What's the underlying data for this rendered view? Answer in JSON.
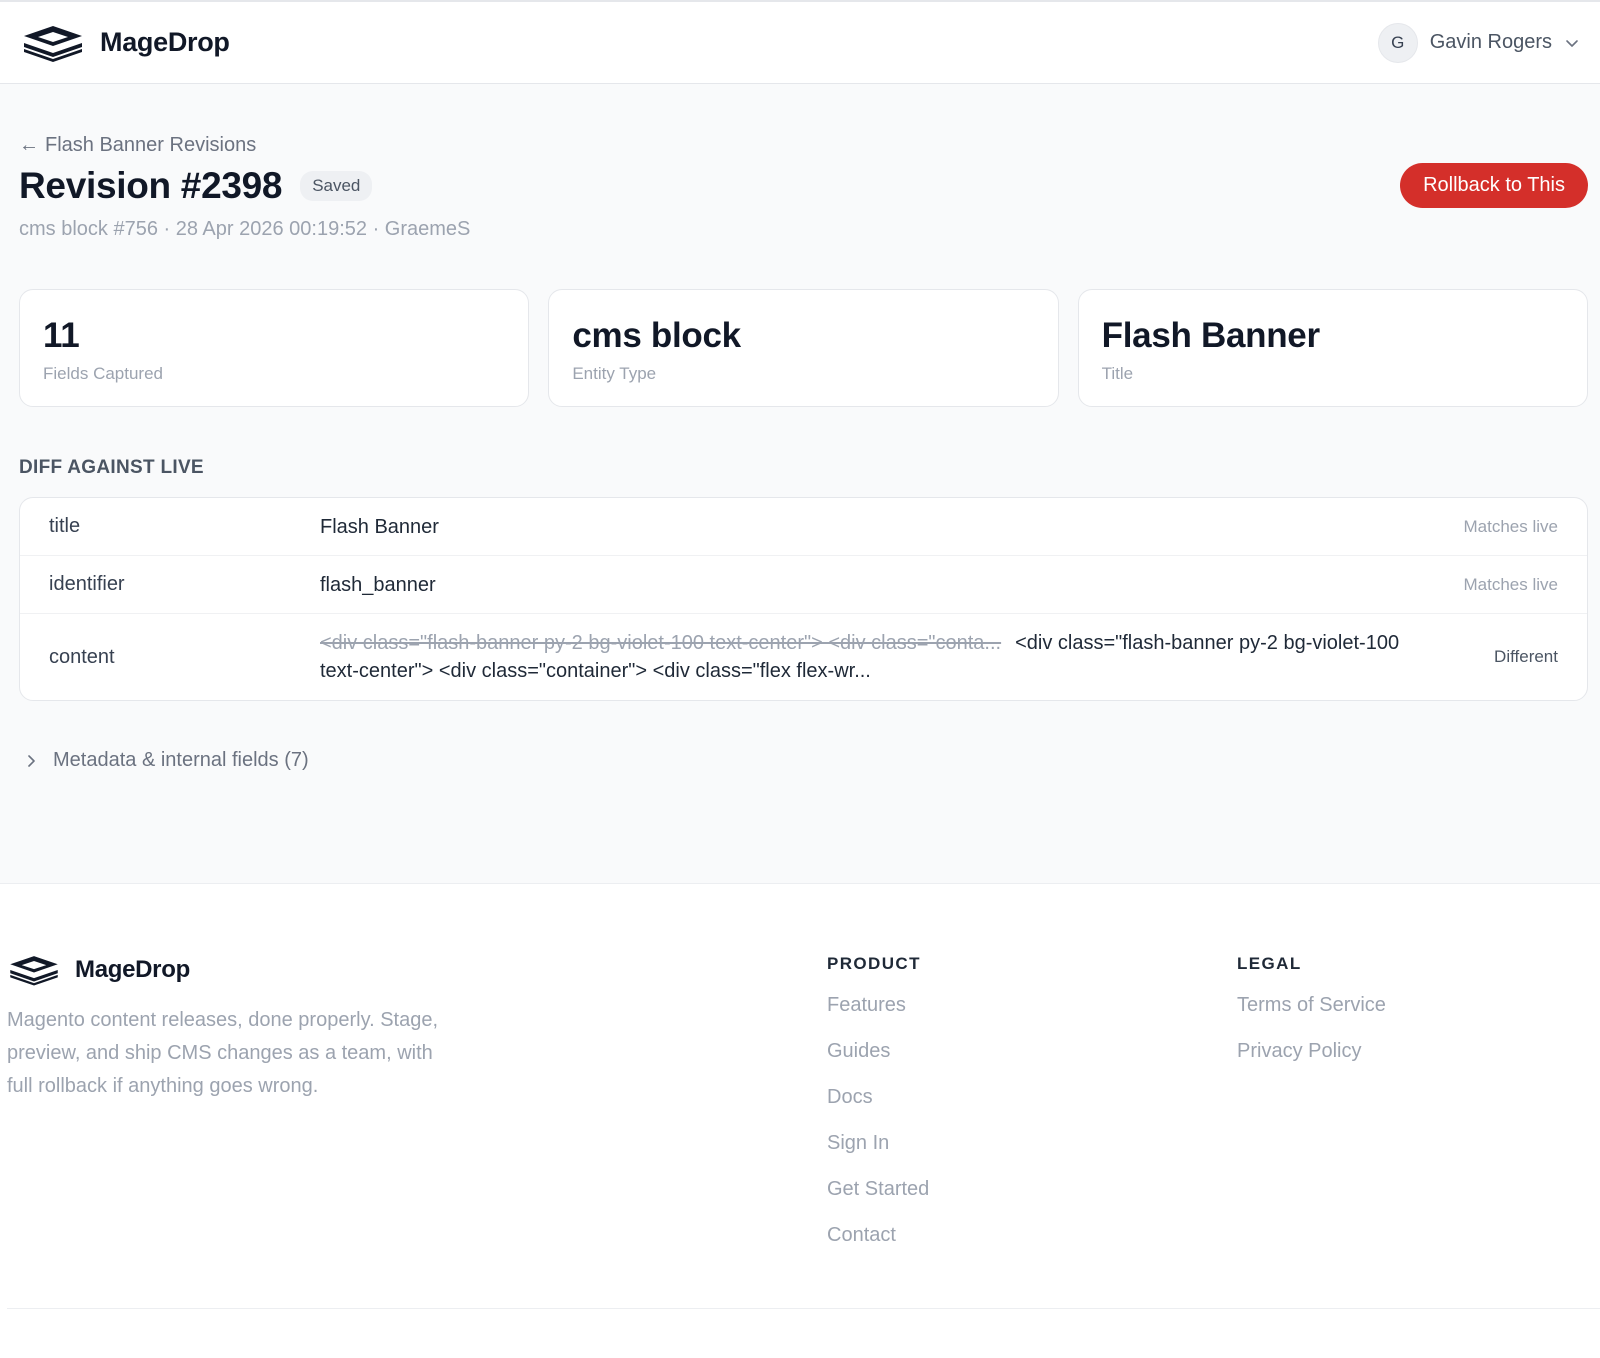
{
  "brand": {
    "name": "MageDrop"
  },
  "user": {
    "initial": "G",
    "name": "Gavin Rogers"
  },
  "breadcrumb": {
    "arrow": "←",
    "label": "Flash Banner Revisions"
  },
  "revision": {
    "title": "Revision #2398",
    "badge": "Saved",
    "subtitle": "cms block #756 · 28 Apr 2026 00:19:52 · GraemeS",
    "rollback_label": "Rollback to This"
  },
  "stats": [
    {
      "value": "11",
      "label": "Fields Captured"
    },
    {
      "value": "cms block",
      "label": "Entity Type"
    },
    {
      "value": "Flash Banner",
      "label": "Title"
    }
  ],
  "diff": {
    "title": "DIFF AGAINST LIVE",
    "rows": [
      {
        "field": "title",
        "value": "Flash Banner",
        "status": "Matches live"
      },
      {
        "field": "identifier",
        "value": "flash_banner",
        "status": "Matches live"
      },
      {
        "field": "content",
        "old_value": "<div class=\"flash-banner py-2 bg-violet-100 text-center\"> <div class=\"conta...",
        "value": "<div class=\"flash-banner py-2 bg-violet-100 text-center\"> <div class=\"container\"> <div class=\"flex flex-wr...",
        "status": "Different"
      }
    ]
  },
  "metadata": {
    "label": "Metadata & internal fields (7)"
  },
  "footer": {
    "brand_name": "MageDrop",
    "description": "Magento content releases, done properly. Stage, preview, and ship CMS changes as a team, with full rollback if anything goes wrong.",
    "product": {
      "title": "PRODUCT",
      "links": [
        "Features",
        "Guides",
        "Docs",
        "Sign In",
        "Get Started",
        "Contact"
      ]
    },
    "legal": {
      "title": "LEGAL",
      "links": [
        "Terms of Service",
        "Privacy Policy"
      ]
    }
  },
  "colors": {
    "accent": "#d42f2a",
    "text": "#111827",
    "muted": "#9ca3af",
    "background": "#f9fafb"
  },
  "icons": {
    "logo": "layers-logo-icon",
    "user_menu": "chevron-down-icon",
    "metadata": "chevron-right-icon"
  }
}
